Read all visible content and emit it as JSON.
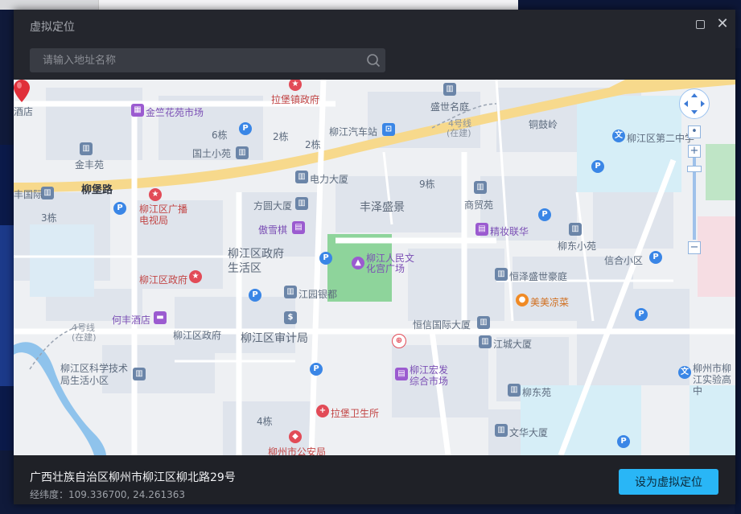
{
  "dialog": {
    "title": "虚拟定位"
  },
  "search": {
    "placeholder": "请输入地址名称",
    "value": ""
  },
  "map": {
    "roads": {
      "liubao": "柳堡路"
    },
    "labels": {
      "jiudian_left": "酒店",
      "jinzhu": "金竺花苑市场",
      "labaozhen": "拉堡镇政府",
      "shengshi": "盛世名庭",
      "line4_a": "4号线",
      "line4_a_sub": "(在建)",
      "tongguling": "铜鼓岭",
      "liujiang_qiche": "柳江汽车站",
      "b6": "6栋",
      "b2a": "2栋",
      "b2b": "2栋",
      "guotu": "国土小苑",
      "jinfeng": "金丰苑",
      "dianli": "电力大厦",
      "b9": "9栋",
      "fengguo": "丰国际",
      "liujiang_tv": "柳江区广播电视局",
      "fangyuan": "方圆大厦",
      "fengze": "丰泽盛景",
      "shangmao": "商贸苑",
      "b3": "3栋",
      "aoxueqi": "傲雪棋",
      "jingzhuang": "精妆联华",
      "liudong_xiao": "柳东小苑",
      "xinhe": "信合小区",
      "zhengfu_shenghuo": "柳江区政府生活区",
      "renmin": "柳江人民文化宫广场",
      "hengtai": "恒泽盛世豪庭",
      "liujiang_zhengfu": "柳江区政府",
      "jiangyuan": "江园银都",
      "meimei": "美美凉菜",
      "hefeng": "何丰酒店",
      "line4_b": "4号线",
      "line4_b_sub": "(在建)",
      "zhengfu2": "柳江区政府",
      "shenji": "柳江区审计局",
      "hengxin": "恒信国际大厦",
      "jiangcheng": "江城大厦",
      "kexue": "柳江区科学技术局生活小区",
      "hongfa": "柳江宏发综合市场",
      "liudongyuan": "柳东苑",
      "labao_weisheng": "拉堡卫生所",
      "b4": "4栋",
      "wenhua": "文华大厦",
      "gonganju": "柳州市公安局",
      "dierzhong": "柳江区第二中学",
      "shiyan": "柳州市柳江实验高中"
    }
  },
  "footer": {
    "address": "广西壮族自治区柳州市柳江区柳北路29号",
    "coords_label": "经纬度：",
    "coords_value": "109.336700, 24.261363",
    "confirm_label": "设为虚拟定位"
  },
  "colors": {
    "accent": "#29b6f6",
    "dialog_bg": "#24262d",
    "marker": "#e02f3a"
  },
  "icons": {
    "search": "search-icon",
    "maximize": "maximize-icon",
    "close": "close-icon",
    "marker": "location-pin-icon"
  }
}
